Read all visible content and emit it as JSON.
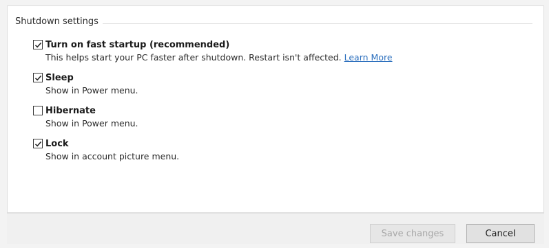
{
  "group": {
    "title": "Shutdown settings"
  },
  "options": [
    {
      "label": "Turn on fast startup (recommended)",
      "checked": true,
      "description": "This helps start your PC faster after shutdown. Restart isn't affected.",
      "link": "Learn More"
    },
    {
      "label": "Sleep",
      "checked": true,
      "description": "Show in Power menu."
    },
    {
      "label": "Hibernate",
      "checked": false,
      "description": "Show in Power menu."
    },
    {
      "label": "Lock",
      "checked": true,
      "description": "Show in account picture menu."
    }
  ],
  "footer": {
    "save_label": "Save changes",
    "cancel_label": "Cancel"
  },
  "colors": {
    "link": "#2a6ebd",
    "window_bg": "#f3f3f3",
    "content_bg": "#ffffff"
  }
}
